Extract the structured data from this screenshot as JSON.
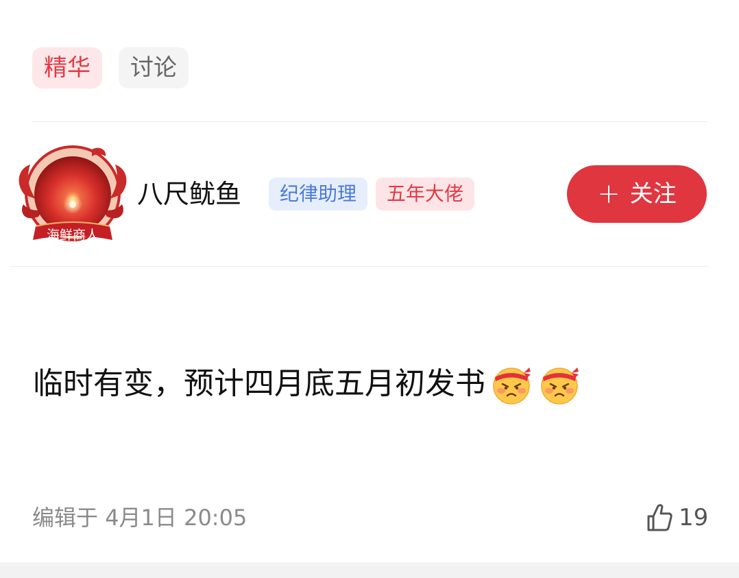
{
  "tags": {
    "featured": "精华",
    "discussion": "讨论"
  },
  "author": {
    "name": "八尺鱿鱼",
    "avatar_frame_text": "海鲜商人",
    "badges": [
      "纪律助理",
      "五年大佬"
    ],
    "follow_button": {
      "icon": "plus-icon",
      "label": "关注"
    }
  },
  "post": {
    "text": "临时有变，预计四月底五月初发书",
    "emojis": [
      "angry-headband-emoji",
      "angry-headband-emoji"
    ]
  },
  "footer": {
    "edited_prefix": "编辑于",
    "edited_time": "4月1日 20:05",
    "like_icon": "thumbs-up-icon",
    "like_count": "19"
  },
  "colors": {
    "accent_red": "#e03640",
    "featured_tag_bg": "#fde7e9",
    "blue_badge_text": "#4a7bd4",
    "muted_text": "#8a8a8a"
  }
}
